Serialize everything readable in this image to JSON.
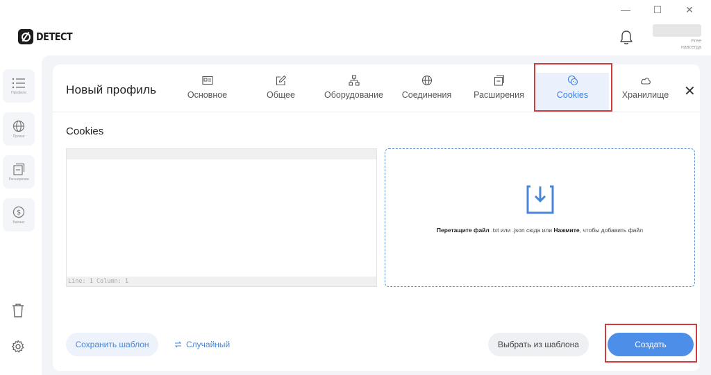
{
  "brand": {
    "name": "DETECT"
  },
  "window_controls": {
    "minimize": "—",
    "maximize": "☐",
    "close": "✕"
  },
  "user": {
    "plan_line1": "Free",
    "plan_line2": "навсегда"
  },
  "sidebar": {
    "items": [
      {
        "label": "Профили",
        "icon": "list-icon"
      },
      {
        "label": "Прокси",
        "icon": "globe-icon"
      },
      {
        "label": "Расширения",
        "icon": "extensions-icon"
      },
      {
        "label": "Баланс",
        "icon": "dollar-icon"
      }
    ]
  },
  "modal": {
    "title": "Новый профиль",
    "close": "✕",
    "tabs": [
      {
        "label": "Основное",
        "icon": "id-card-icon"
      },
      {
        "label": "Общее",
        "icon": "edit-icon"
      },
      {
        "label": "Оборудование",
        "icon": "hierarchy-icon"
      },
      {
        "label": "Соединения",
        "icon": "globe-icon"
      },
      {
        "label": "Расширения",
        "icon": "extensions-icon"
      },
      {
        "label": "Cookies",
        "icon": "cookie-icon",
        "active": true
      },
      {
        "label": "Хранилище",
        "icon": "cloud-icon"
      }
    ],
    "section_title": "Cookies",
    "editor": {
      "status": "Line: 1  Column: 1"
    },
    "dropzone": {
      "text_bold1": "Перетащите файл",
      "text_mid": " .txt или .json сюда или ",
      "text_bold2": "Нажмите",
      "text_end": ", чтобы добавить файл"
    },
    "buttons": {
      "save_template": "Сохранить шаблон",
      "random": "Случайный",
      "choose_template": "Выбрать из шаблона",
      "create": "Создать"
    }
  },
  "colors": {
    "accent": "#4d8ee8",
    "highlight": "#d23b3b"
  }
}
